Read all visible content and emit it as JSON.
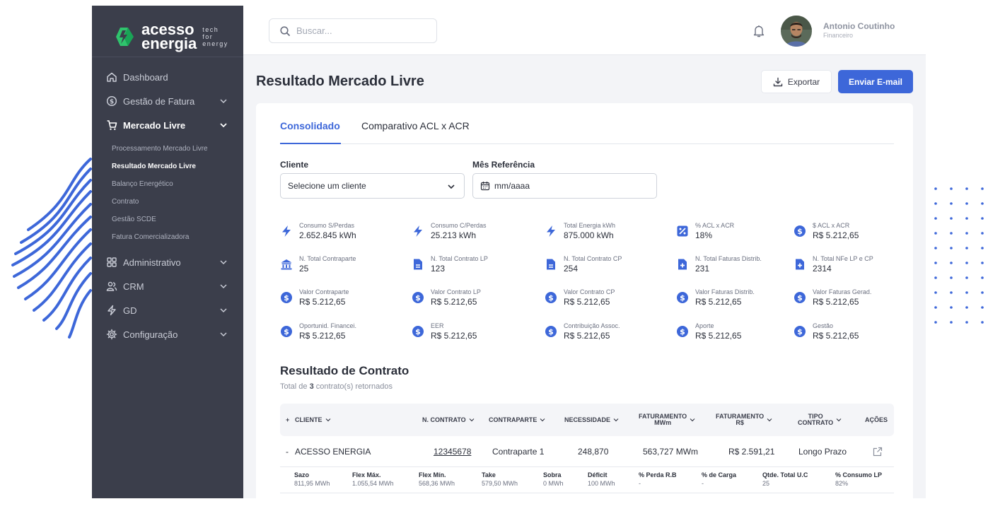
{
  "brand": {
    "name_line1": "acesso",
    "name_line2": "energia",
    "tag_line1": "tech",
    "tag_line2": "for",
    "tag_line3": "energy"
  },
  "sidebar": {
    "items": [
      {
        "label": "Dashboard",
        "icon": "home-icon"
      },
      {
        "label": "Gestão de Fatura",
        "icon": "dollar-circle-icon"
      },
      {
        "label": "Mercado Livre",
        "icon": "cart-icon"
      },
      {
        "label": "Administrativo",
        "icon": "grid-icon"
      },
      {
        "label": "CRM",
        "icon": "users-icon"
      },
      {
        "label": "GD",
        "icon": "bolt-icon"
      },
      {
        "label": "Configuração",
        "icon": "gear-icon"
      }
    ],
    "subitems": [
      "Processamento Mercado Livre",
      "Resultado Mercado Livre",
      "Balanço Energético",
      "Contrato",
      "Gestão SCDE",
      "Fatura Comercializadora"
    ]
  },
  "topbar": {
    "search_placeholder": "Buscar...",
    "user_name": "Antonio Coutinho",
    "user_role": "Financeiro"
  },
  "page": {
    "title": "Resultado Mercado Livre",
    "export_label": "Exportar",
    "email_label": "Enviar E-mail"
  },
  "tabs": [
    "Consolidado",
    "Comparativo ACL x ACR"
  ],
  "filters": {
    "client_label": "Cliente",
    "client_value": "Selecione um cliente",
    "month_label": "Mês Referência",
    "month_value": "mm/aaaa"
  },
  "stats": [
    {
      "label": "Consumo S/Perdas",
      "value": "2.652.845 kWh",
      "icon": "bolt-icon"
    },
    {
      "label": "Consumo C/Perdas",
      "value": "25.213 kWh",
      "icon": "bolt-icon"
    },
    {
      "label": "Total Energia kWh",
      "value": "875.000 kWh",
      "icon": "bolt-icon"
    },
    {
      "label": "% ACL x ACR",
      "value": "18%",
      "icon": "percent-icon"
    },
    {
      "label": "$ ACL x ACR",
      "value": "R$ 5.212,65",
      "icon": "dollar-icon"
    },
    {
      "label": "N. Total Contraparte",
      "value": "25",
      "icon": "bank-icon"
    },
    {
      "label": "N. Total Contrato LP",
      "value": "123",
      "icon": "document-icon"
    },
    {
      "label": "N. Total Contrato CP",
      "value": "254",
      "icon": "document-icon"
    },
    {
      "label": "N. Total Faturas Distrib.",
      "value": "231",
      "icon": "file-plus-icon"
    },
    {
      "label": "N. Total NFe LP e CP",
      "value": "2314",
      "icon": "file-plus-icon"
    },
    {
      "label": "Valor Contraparte",
      "value": "R$ 5.212,65",
      "icon": "dollar-icon"
    },
    {
      "label": "Valor Contrato LP",
      "value": "R$ 5.212,65",
      "icon": "dollar-icon"
    },
    {
      "label": "Valor Contrato CP",
      "value": "R$ 5.212,65",
      "icon": "dollar-icon"
    },
    {
      "label": "Valor Faturas Distrib.",
      "value": "R$ 5.212,65",
      "icon": "dollar-icon"
    },
    {
      "label": "Valor Faturas Gerad.",
      "value": "R$ 5.212,65",
      "icon": "dollar-icon"
    },
    {
      "label": "Oportunid. Financei.",
      "value": "R$ 5.212,65",
      "icon": "dollar-icon"
    },
    {
      "label": "EER",
      "value": "R$ 5.212,65",
      "icon": "dollar-icon"
    },
    {
      "label": "Contribuição Assoc.",
      "value": "R$ 5.212,65",
      "icon": "dollar-icon"
    },
    {
      "label": "Aporte",
      "value": "R$ 5.212,65",
      "icon": "dollar-icon"
    },
    {
      "label": "Gestão",
      "value": "R$ 5.212,65",
      "icon": "dollar-icon"
    }
  ],
  "contracts": {
    "title": "Resultado de Contrato",
    "total_prefix": "Total de",
    "total_count": "3",
    "total_suffix": "contrato(s) retornados",
    "columns": {
      "expand": "+",
      "client": "CLIENTE",
      "contract": "N. CONTRATO",
      "counterpart": "CONTRAPARTE",
      "need": "NECESSIDADE",
      "billing_mwm_1": "FATURAMENTO",
      "billing_mwm_2": "MWm",
      "billing_rs_1": "FATURAMENTO",
      "billing_rs_2": "R$",
      "type_1": "TIPO",
      "type_2": "CONTRATO",
      "actions": "AÇÕES"
    },
    "row": {
      "toggle": "-",
      "client": "ACESSO ENERGIA",
      "contract": "12345678",
      "counterpart": "Contraparte 1",
      "need": "248,870",
      "billing_mwm": "563,727 MWm",
      "billing_rs": "R$ 2.591,21",
      "type": "Longo Prazo"
    },
    "details": [
      {
        "label": "Sazo",
        "value": "811,95 MWh"
      },
      {
        "label": "Flex Máx.",
        "value": "1.055,54 MWh"
      },
      {
        "label": "Flex Mín.",
        "value": "568,36 MWh"
      },
      {
        "label": "Take",
        "value": "579,50 MWh"
      },
      {
        "label": "Sobra",
        "value": "0 MWh"
      },
      {
        "label": "Déficit",
        "value": "100 MWh"
      },
      {
        "label": "% Perda R.B",
        "value": "-"
      },
      {
        "label": "% de Carga",
        "value": "-"
      },
      {
        "label": "Qtde. Total U.C",
        "value": "25"
      },
      {
        "label": "% Consumo LP",
        "value": "82%"
      }
    ]
  },
  "colors": {
    "accent": "#3d67d9",
    "sidebar": "#3b3e4b",
    "background": "#f3f4f7"
  }
}
